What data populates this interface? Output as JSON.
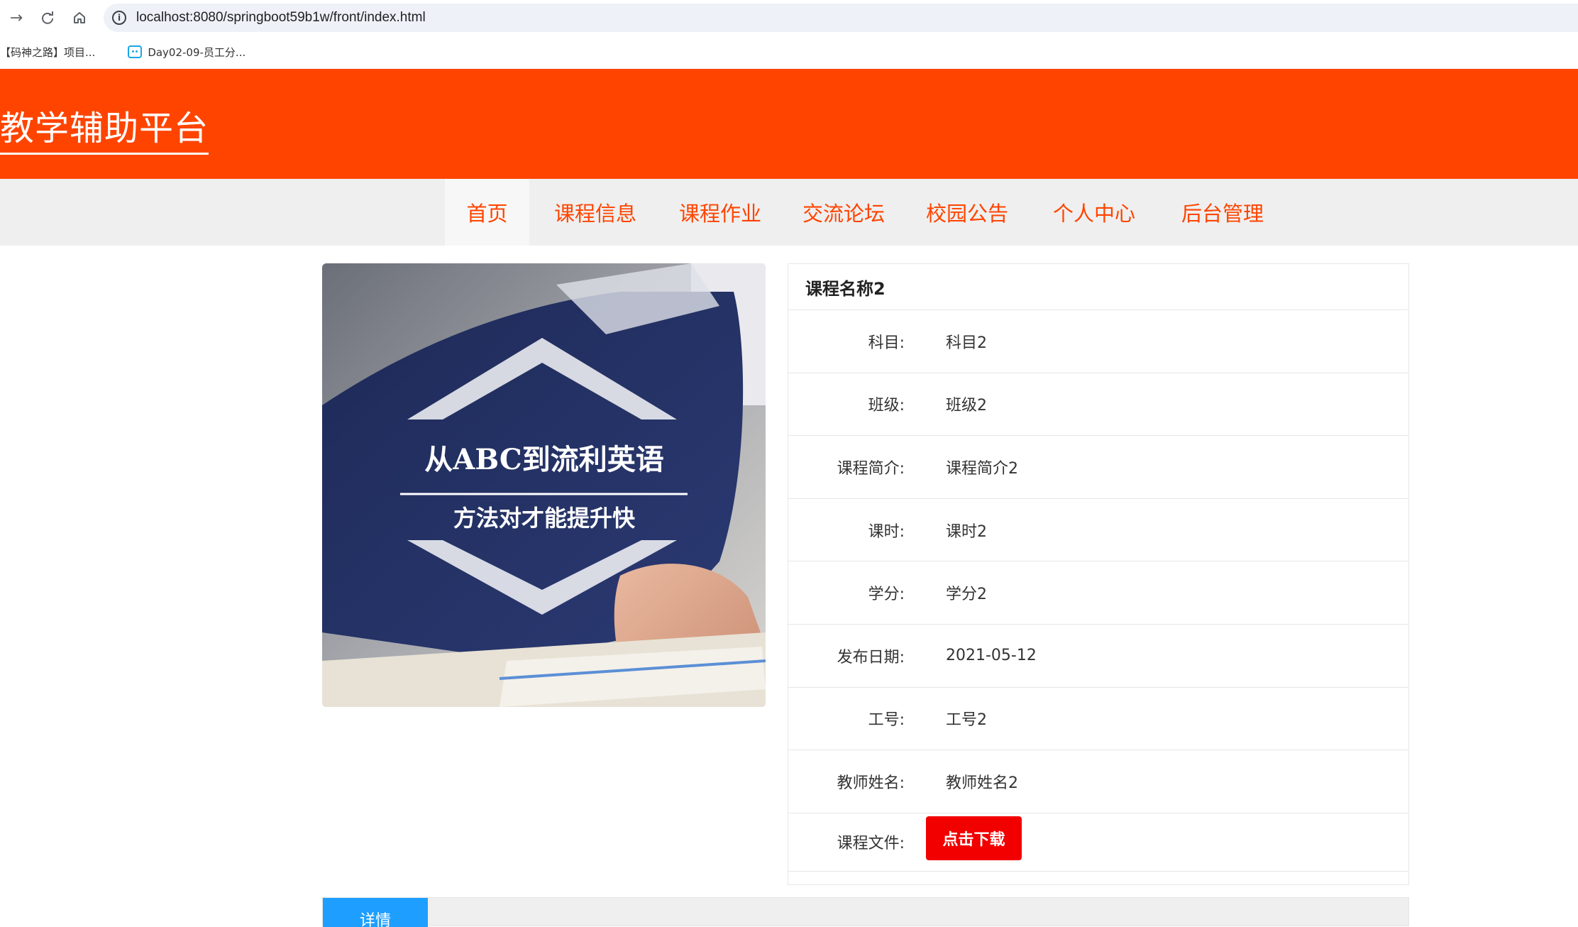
{
  "browser": {
    "url": "localhost:8080/springboot59b1w/front/index.html",
    "bookmarks": [
      {
        "label": "【码神之路】项目..."
      },
      {
        "label": "Day02-09-员工分..."
      }
    ]
  },
  "site": {
    "title": "教学辅助平台",
    "accent_color": "#ff4400"
  },
  "nav": {
    "items": [
      "首页",
      "课程信息",
      "课程作业",
      "交流论坛",
      "校园公告",
      "个人中心",
      "后台管理"
    ],
    "active_index": 0
  },
  "course": {
    "image": {
      "headline": "从ABC到流利英语",
      "subline": "方法对才能提升快"
    },
    "name": "课程名称2",
    "fields": [
      {
        "label": "科目:",
        "value": "科目2"
      },
      {
        "label": "班级:",
        "value": "班级2"
      },
      {
        "label": "课程简介:",
        "value": "课程简介2"
      },
      {
        "label": "课时:",
        "value": "课时2"
      },
      {
        "label": "学分:",
        "value": "学分2"
      },
      {
        "label": "发布日期:",
        "value": "2021-05-12"
      },
      {
        "label": "工号:",
        "value": "工号2"
      },
      {
        "label": "教师姓名:",
        "value": "教师姓名2"
      }
    ],
    "file": {
      "label": "课程文件:",
      "button": "点击下载"
    }
  },
  "tabs": {
    "detail": "详情"
  }
}
